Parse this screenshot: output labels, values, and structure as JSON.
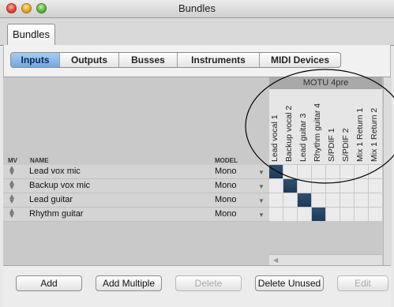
{
  "window": {
    "title": "Bundles"
  },
  "outer_tab": {
    "label": "Bundles"
  },
  "subtabs": [
    {
      "label": "Inputs",
      "selected": true
    },
    {
      "label": "Outputs",
      "selected": false
    },
    {
      "label": "Busses",
      "selected": false
    },
    {
      "label": "Instruments",
      "selected": false
    },
    {
      "label": "MIDI Devices",
      "selected": false
    }
  ],
  "table": {
    "headers": {
      "mv": "MV",
      "name": "NAME",
      "model": "MODEL"
    },
    "rows": [
      {
        "name": "Lead vox mic",
        "model": "Mono"
      },
      {
        "name": "Backup vox mic",
        "model": "Mono"
      },
      {
        "name": "Lead guitar",
        "model": "Mono"
      },
      {
        "name": "Rhythm guitar",
        "model": "Mono"
      }
    ]
  },
  "matrix": {
    "device": "MOTU 4pre",
    "columns": [
      "Lead vocal 1",
      "Backup vocal 2",
      "Lead guitar 3",
      "Rhythm guitar 4",
      "S/PDIF 1",
      "S/PDIF 2",
      "Mix 1 Return 1",
      "Mix 1 Return 2"
    ],
    "connections": [
      [
        0,
        0
      ],
      [
        1,
        1
      ],
      [
        2,
        2
      ],
      [
        3,
        3
      ]
    ],
    "on_color": "#1f3e5c"
  },
  "buttons": {
    "add": "Add",
    "add_multiple": "Add Multiple",
    "delete": "Delete",
    "delete_unused": "Delete Unused",
    "edit": "Edit"
  },
  "colors": {
    "accent": "#6fa7e2",
    "annotation": "#000000"
  }
}
